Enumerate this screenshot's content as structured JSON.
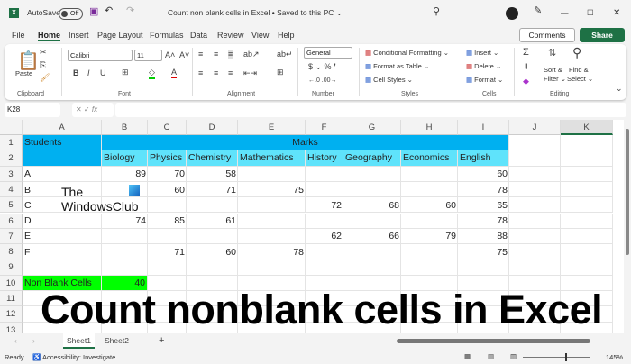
{
  "titlebar": {
    "autosave": "AutoSave",
    "toggle": "Off",
    "doc_title": "Count non blank cells in Excel • Saved to this PC ⌄"
  },
  "menu": {
    "tabs": [
      "File",
      "Home",
      "Insert",
      "Page Layout",
      "Formulas",
      "Data",
      "Review",
      "View",
      "Help"
    ],
    "comments": "Comments",
    "share": "Share"
  },
  "ribbon": {
    "paste": "Paste",
    "font_name": "Calibri",
    "font_size": "11",
    "number_format": "General",
    "cond_format": "Conditional Formatting ⌄",
    "format_table": "Format as Table ⌄",
    "cell_styles": "Cell Styles ⌄",
    "insert": "Insert",
    "delete": "Delete",
    "format": "Format ⌄",
    "sort": "Sort &",
    "filter": "Filter ⌄",
    "find": "Find &",
    "select": "Select ⌄",
    "groups": [
      "Clipboard",
      "Font",
      "Alignment",
      "Number",
      "Styles",
      "Cells",
      "Editing"
    ]
  },
  "formula_bar": {
    "name_box": "K28",
    "fx": "fx",
    "value": ""
  },
  "columns": [
    "A",
    "B",
    "C",
    "D",
    "E",
    "F",
    "G",
    "H",
    "I",
    "J",
    "K"
  ],
  "rows": [
    "1",
    "2",
    "3",
    "4",
    "5",
    "6",
    "7",
    "8",
    "9",
    "10",
    "11",
    "12",
    "13"
  ],
  "header": {
    "students": "Students",
    "marks": "Marks",
    "subjects": [
      "Biology",
      "Physics",
      "Chemistry",
      "Mathematics",
      "History",
      "Geography",
      "Economics",
      "English"
    ]
  },
  "table": [
    [
      "A",
      "89",
      "70",
      "58",
      "",
      "",
      "",
      "",
      "60"
    ],
    [
      "B",
      "",
      "60",
      "71",
      "75",
      "",
      "",
      "",
      "78"
    ],
    [
      "C",
      "",
      "",
      "",
      "",
      "72",
      "68",
      "60",
      "65"
    ],
    [
      "D",
      "74",
      "85",
      "61",
      "",
      "",
      "",
      "",
      "78"
    ],
    [
      "E",
      "",
      "",
      "",
      "",
      "62",
      "66",
      "79",
      "88"
    ],
    [
      "F",
      "",
      "71",
      "60",
      "78",
      "",
      "",
      "",
      "75"
    ]
  ],
  "summary": {
    "label": "Non Blank Cells",
    "value": "40"
  },
  "overlay_text": "Count nonblank cells in Excel",
  "watermark": {
    "line1": "The",
    "line2": "WindowsClub"
  },
  "sheets": [
    "Sheet1",
    "Sheet2"
  ],
  "status": {
    "ready": "Ready",
    "accessibility": "Accessibility: Investigate",
    "zoom": "145%"
  },
  "colors": {
    "header_dark": "#00b0f0",
    "header_light": "#5fe3fb",
    "summary": "#00ff00",
    "excel_green": "#1e7145"
  }
}
